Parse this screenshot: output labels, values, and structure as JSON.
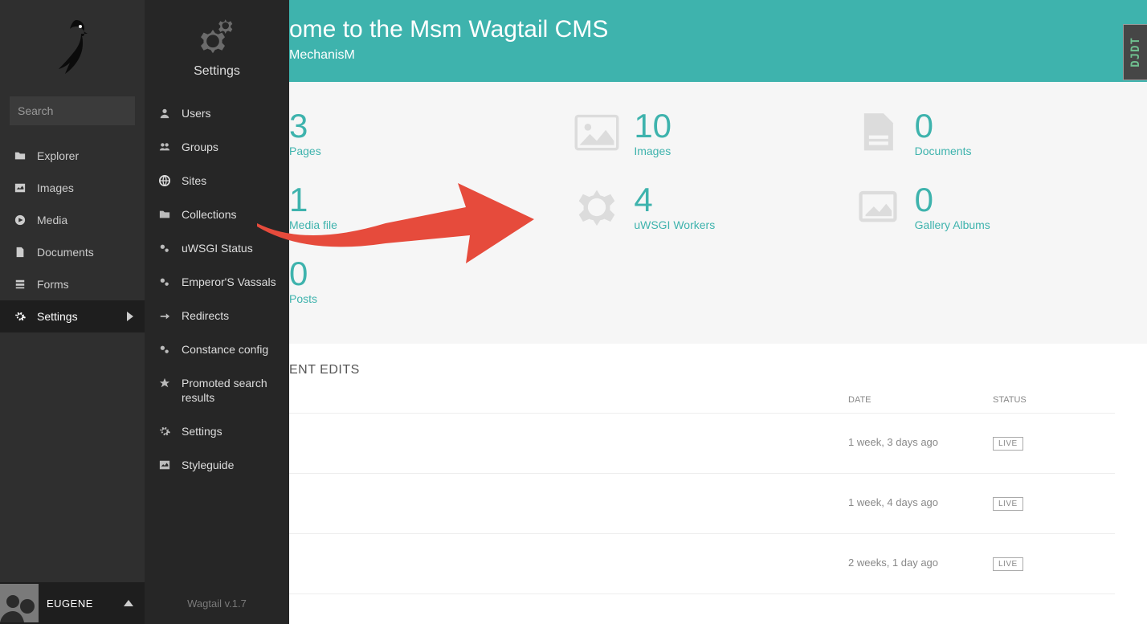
{
  "search": {
    "placeholder": "Search"
  },
  "nav": [
    {
      "id": "explorer",
      "label": "Explorer",
      "icon": "folder"
    },
    {
      "id": "images",
      "label": "Images",
      "icon": "image"
    },
    {
      "id": "media",
      "label": "Media",
      "icon": "play"
    },
    {
      "id": "documents",
      "label": "Documents",
      "icon": "file"
    },
    {
      "id": "forms",
      "label": "Forms",
      "icon": "form"
    },
    {
      "id": "settings",
      "label": "Settings",
      "icon": "gear",
      "active": true,
      "chevron": true
    }
  ],
  "user": {
    "name": "EUGENE"
  },
  "submenu": {
    "title": "Settings",
    "items": [
      {
        "id": "users",
        "label": "Users",
        "icon": "user"
      },
      {
        "id": "groups",
        "label": "Groups",
        "icon": "group"
      },
      {
        "id": "sites",
        "label": "Sites",
        "icon": "globe"
      },
      {
        "id": "collections",
        "label": "Collections",
        "icon": "folder"
      },
      {
        "id": "uwsgi",
        "label": "uWSGI Status",
        "icon": "gears"
      },
      {
        "id": "emperor",
        "label": "Emperor'S Vassals",
        "icon": "gears"
      },
      {
        "id": "redirects",
        "label": "Redirects",
        "icon": "redirect"
      },
      {
        "id": "constance",
        "label": "Constance config",
        "icon": "gears"
      },
      {
        "id": "promoted",
        "label": "Promoted search results",
        "icon": "star"
      },
      {
        "id": "settings2",
        "label": "Settings",
        "icon": "gear"
      },
      {
        "id": "styleguide",
        "label": "Styleguide",
        "icon": "image"
      }
    ],
    "version": "Wagtail v.1.7"
  },
  "hero": {
    "title_visible": "ome to the Msm Wagtail CMS",
    "subtitle_visible": "MechanisM"
  },
  "stats": [
    {
      "value": "3",
      "label": "Pages",
      "icon": "page"
    },
    {
      "value": "10",
      "label": "Images",
      "icon": "image"
    },
    {
      "value": "0",
      "label": "Documents",
      "icon": "doc"
    },
    {
      "value": "1",
      "label": "Media file",
      "icon": "media"
    },
    {
      "value": "4",
      "label": "uWSGI Workers",
      "icon": "gear"
    },
    {
      "value": "0",
      "label": "Gallery Albums",
      "icon": "gallery"
    },
    {
      "value": "0",
      "label": "Posts",
      "icon": "post"
    }
  ],
  "recent": {
    "heading_visible": "ENT EDITS",
    "columns": {
      "date": "DATE",
      "status": "STATUS"
    },
    "rows": [
      {
        "date": "1 week, 3 days ago",
        "status": "LIVE"
      },
      {
        "date": "1 week, 4 days ago",
        "status": "LIVE"
      },
      {
        "date": "2 weeks, 1 day ago",
        "status": "LIVE"
      }
    ]
  },
  "djdt": {
    "label": "DJDT"
  }
}
